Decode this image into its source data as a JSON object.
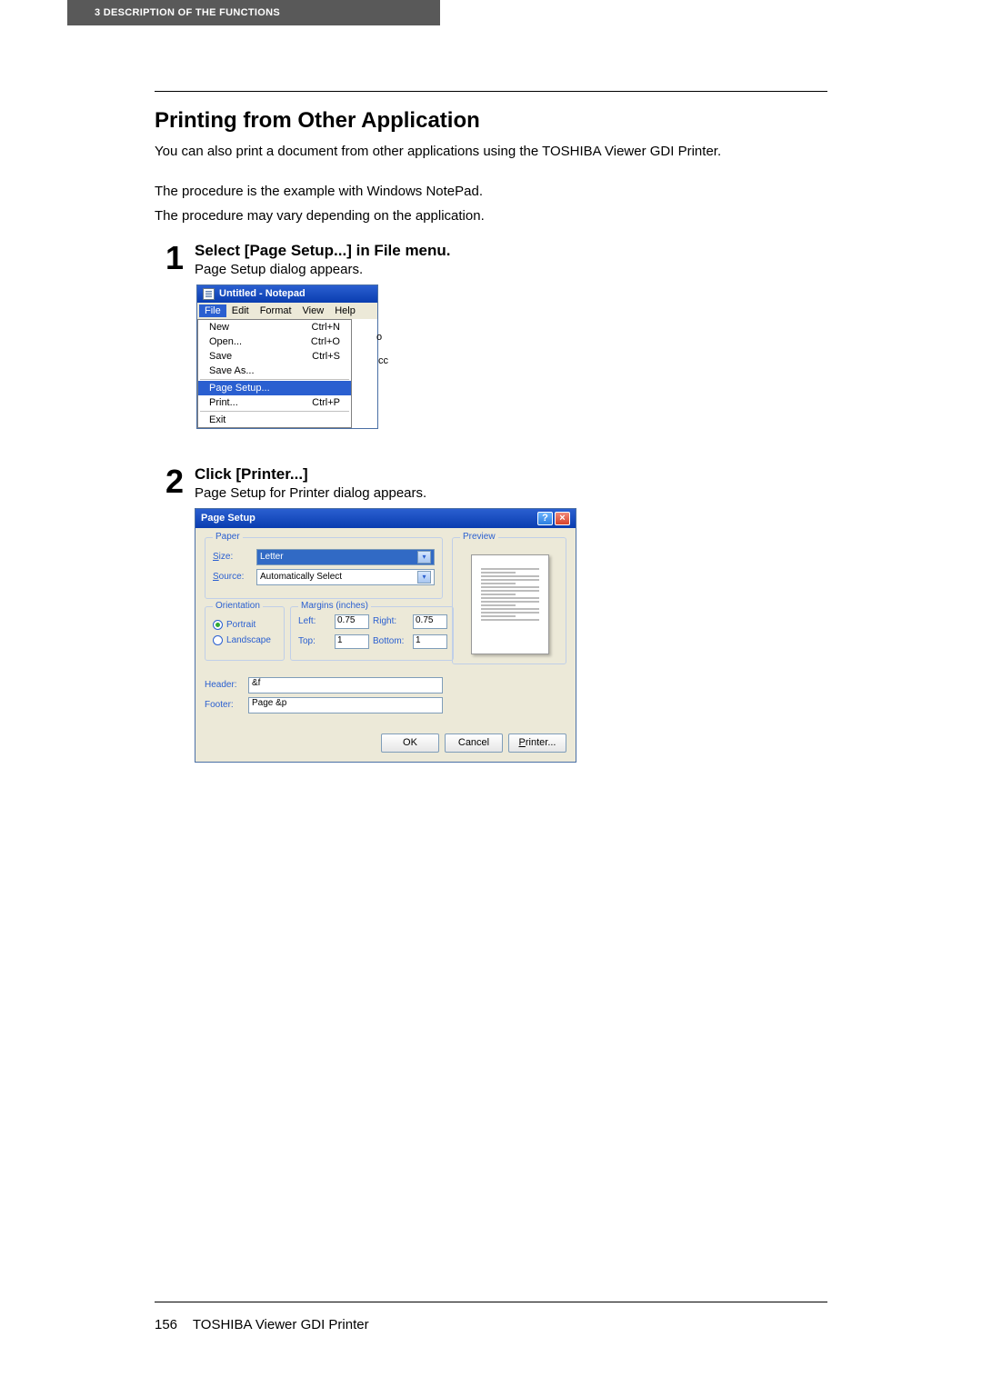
{
  "header": {
    "chapter": "3   DESCRIPTION OF THE FUNCTIONS"
  },
  "section": {
    "title": "Printing from Other Application",
    "intro1": "You can also print a document from other applications using the TOSHIBA Viewer GDI Printer.",
    "intro2": "The procedure is the example with Windows NotePad.",
    "intro3": "The procedure may vary depending on the application."
  },
  "steps": [
    {
      "num": "1",
      "title": "Select [Page Setup...] in File menu.",
      "sub": "Page Setup dialog appears."
    },
    {
      "num": "2",
      "title": "Click [Printer...]",
      "sub": "Page Setup for Printer dialog appears."
    }
  ],
  "notepad": {
    "title": "Untitled - Notepad",
    "menus": [
      "File",
      "Edit",
      "Format",
      "View",
      "Help"
    ],
    "file_menu": {
      "new": {
        "label": "New",
        "accel": "Ctrl+N"
      },
      "open": {
        "label": "Open...",
        "accel": "Ctrl+O"
      },
      "save": {
        "label": "Save",
        "accel": "Ctrl+S"
      },
      "saveas": {
        "label": "Save As...",
        "accel": ""
      },
      "pagesetup": {
        "label": "Page Setup...",
        "accel": ""
      },
      "print": {
        "label": "Print...",
        "accel": "Ctrl+P"
      },
      "exit": {
        "label": "Exit",
        "accel": ""
      }
    },
    "clipped_text_o": "o",
    "clipped_text_cc": "cc"
  },
  "pagesetup_dialog": {
    "title": "Page Setup",
    "paper": {
      "legend": "Paper",
      "size_label": "Size:",
      "size_value": "Letter",
      "source_label": "Source:",
      "source_value": "Automatically Select"
    },
    "orientation": {
      "legend": "Orientation",
      "portrait": "Portrait",
      "landscape": "Landscape"
    },
    "margins": {
      "legend": "Margins (inches)",
      "left_label": "Left:",
      "left_value": "0.75",
      "right_label": "Right:",
      "right_value": "0.75",
      "top_label": "Top:",
      "top_value": "1",
      "bottom_label": "Bottom:",
      "bottom_value": "1"
    },
    "preview_legend": "Preview",
    "header_label": "Header:",
    "header_value": "&f",
    "footer_label": "Footer:",
    "footer_value": "Page &p",
    "buttons": {
      "ok": "OK",
      "cancel": "Cancel",
      "printer": "Printer..."
    }
  },
  "footer": {
    "page_number": "156",
    "product": "TOSHIBA Viewer GDI Printer"
  }
}
